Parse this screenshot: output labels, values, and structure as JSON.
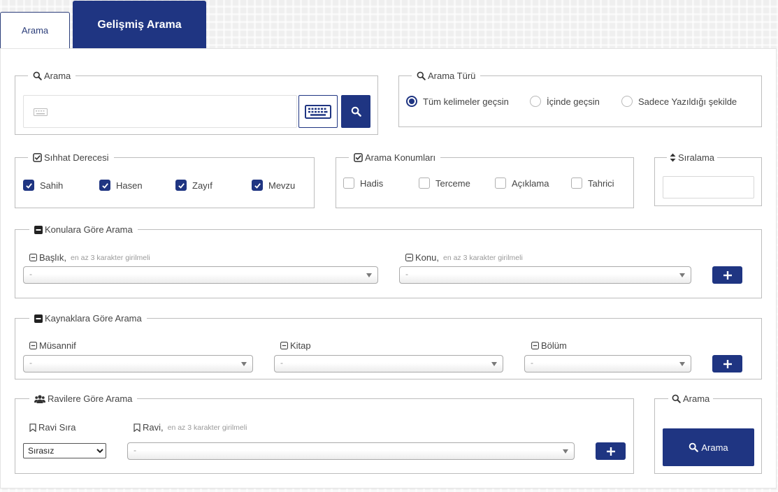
{
  "tabs": {
    "simple": "Arama",
    "advanced": "Gelişmiş Arama"
  },
  "search": {
    "legend": "Arama",
    "input_value": ""
  },
  "search_type": {
    "legend": "Arama Türü",
    "options": [
      "Tüm kelimeler geçsin",
      "İçinde geçsin",
      "Sadece Yazıldığı şekilde"
    ],
    "selected": 0
  },
  "authenticity": {
    "legend": "Sıhhat Derecesi",
    "options": [
      {
        "label": "Sahih",
        "checked": true
      },
      {
        "label": "Hasen",
        "checked": true
      },
      {
        "label": "Zayıf",
        "checked": true
      },
      {
        "label": "Mevzu",
        "checked": true
      }
    ]
  },
  "locations": {
    "legend": "Arama Konumları",
    "options": [
      {
        "label": "Hadis",
        "checked": false
      },
      {
        "label": "Terceme",
        "checked": false
      },
      {
        "label": "Açıklama",
        "checked": false
      },
      {
        "label": "Tahrici",
        "checked": false
      }
    ]
  },
  "sorting": {
    "legend": "Sıralama",
    "value": ""
  },
  "topics": {
    "legend": "Konulara Göre Arama",
    "title_label": "Başlık,",
    "title_hint": "en az 3 karakter girilmeli",
    "title_value": "-",
    "topic_label": "Konu,",
    "topic_hint": "en az 3 karakter girilmeli",
    "topic_value": "-"
  },
  "sources": {
    "legend": "Kaynaklara Göre Arama",
    "author_label": "Müsannif",
    "author_value": "-",
    "book_label": "Kitap",
    "book_value": "-",
    "section_label": "Bölüm",
    "section_value": "-"
  },
  "narrators": {
    "legend": "Ravilere Göre Arama",
    "order_label": "Ravi Sıra",
    "order_value": "Sırasız",
    "narrator_label": "Ravi,",
    "narrator_hint": "en az 3 karakter girilmeli",
    "narrator_value": "-"
  },
  "submit": {
    "legend": "Arama",
    "button_label": "Arama"
  },
  "colors": {
    "primary": "#1f3582",
    "border": "#bdbdbd"
  }
}
